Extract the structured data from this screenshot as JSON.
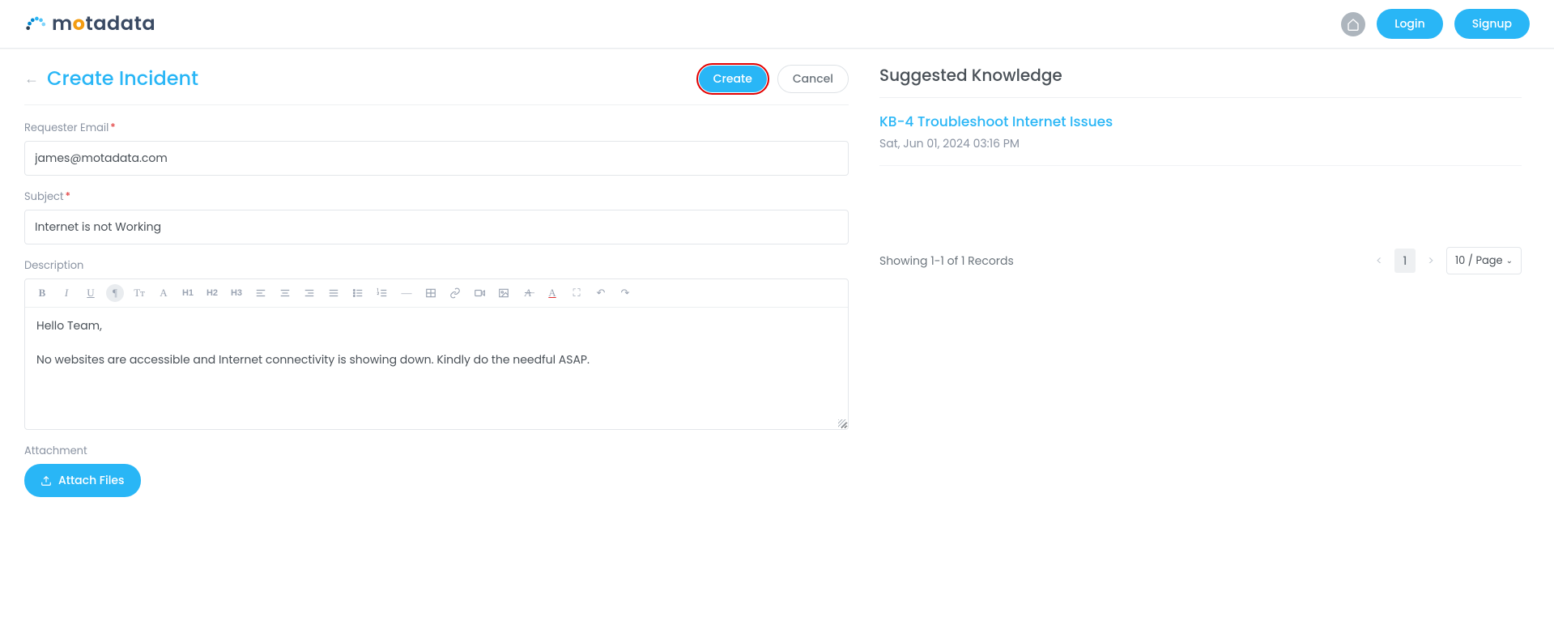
{
  "header": {
    "brand": "motadata",
    "login_label": "Login",
    "signup_label": "Signup"
  },
  "page": {
    "title": "Create Incident",
    "create_label": "Create",
    "cancel_label": "Cancel"
  },
  "form": {
    "requester_label": "Requester Email",
    "requester_value": "james@motadata.com",
    "subject_label": "Subject",
    "subject_value": "Internet is not Working",
    "description_label": "Description",
    "description_line1": "Hello Team,",
    "description_line2": "No websites are accessible and Internet connectivity is showing down. Kindly do the needful ASAP.",
    "attachment_label": "Attachment",
    "attach_button": "Attach Files"
  },
  "toolbar": {
    "bold": "B",
    "italic": "I",
    "underline": "U",
    "para": "¶",
    "fontsize": "Tᴛ",
    "fontcolor": "A",
    "h1": "H1",
    "h2": "H2",
    "h3": "H3",
    "align_left": "≡",
    "align_center": "≡",
    "align_right": "≡",
    "align_just": "≡",
    "ul": "•≡",
    "ol": "1≡",
    "hr": "—",
    "table": "▦",
    "link": "🔗",
    "code": "▣",
    "image": "🖼",
    "clear": "A̶",
    "textcolor": "A",
    "fullscreen": "⛶",
    "undo": "↶",
    "redo": "↷"
  },
  "knowledge": {
    "title": "Suggested Knowledge",
    "items": [
      {
        "title": "KB-4 Troubleshoot Internet Issues",
        "meta": "Sat, Jun 01, 2024 03:16 PM"
      }
    ],
    "showing": "Showing 1-1 of 1 Records",
    "page": "1",
    "per_page": "10 / Page"
  }
}
